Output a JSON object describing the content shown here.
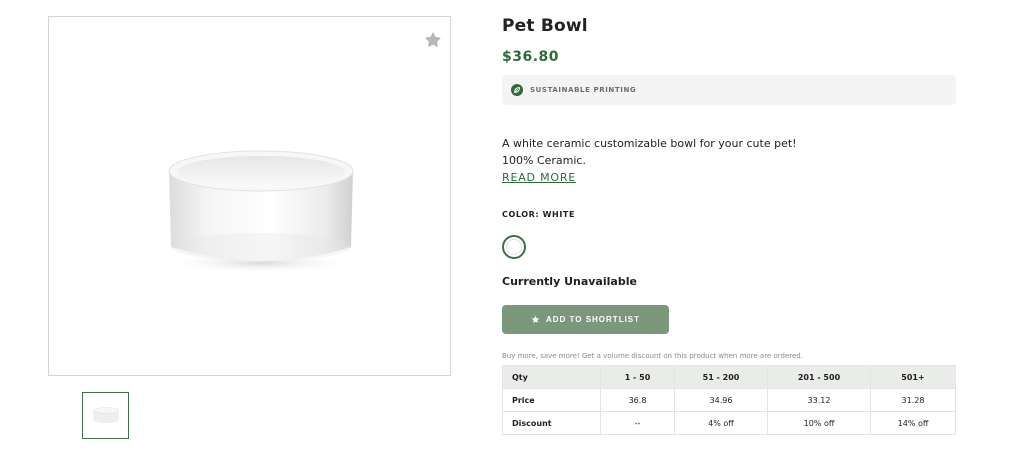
{
  "product": {
    "title": "Pet Bowl",
    "price": "$36.80",
    "sustainable_label": "SUSTAINABLE PRINTING",
    "description_line1": "A white ceramic customizable bowl for your cute pet!",
    "description_line2": "100% Ceramic.",
    "read_more": "READ MORE",
    "color_label": "COLOR: WHITE",
    "availability": "Currently Unavailable",
    "shortlist_button": "ADD TO SHORTLIST",
    "volume_note": "Buy more, save more! Get a volume discount on this product when more are ordered."
  },
  "discount_table": {
    "headers": [
      "Qty",
      "1 - 50",
      "51 - 200",
      "201 - 500",
      "501+"
    ],
    "rows": [
      [
        "Price",
        "36.8",
        "34.96",
        "33.12",
        "31.28"
      ],
      [
        "Discount",
        "--",
        "4% off",
        "10% off",
        "14% off"
      ]
    ]
  },
  "icons": {
    "favorite": "star-icon",
    "sustainable": "leaf-icon",
    "button": "star-icon"
  },
  "colors": {
    "accent_green": "#2f6b3a",
    "button_green": "#7b987d",
    "table_header": "#e9ece8"
  }
}
